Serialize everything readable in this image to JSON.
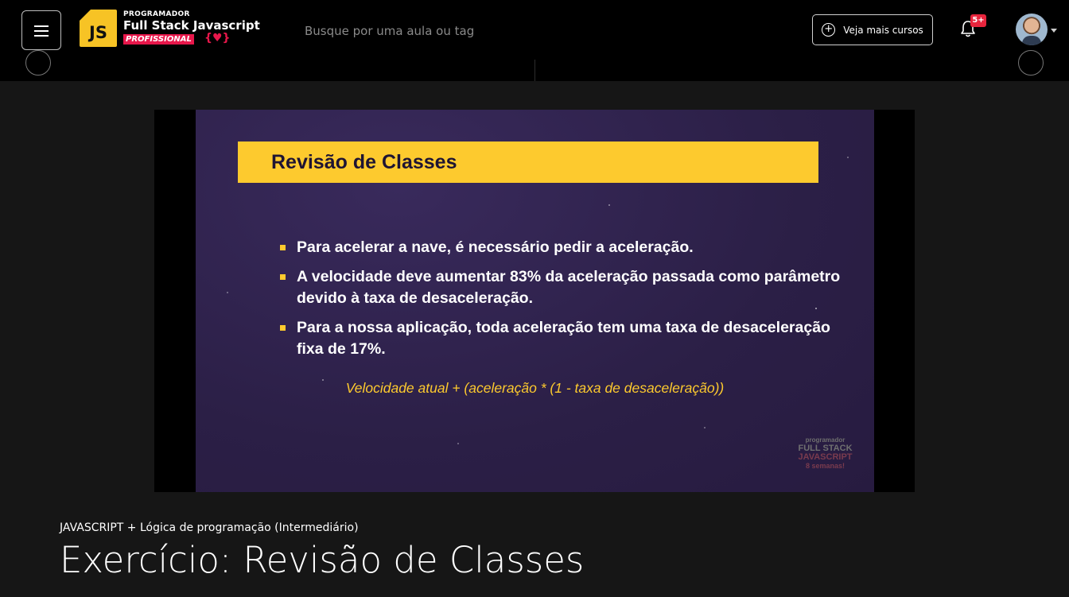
{
  "header": {
    "logo": {
      "badge": "JS",
      "line1": "PROGRAMADOR",
      "line2": "Full Stack Javascript",
      "line3": "PROFISSIONAL",
      "line4": "{♥}"
    },
    "search_placeholder": "Busque por uma aula ou tag",
    "more_courses_label": "Veja mais cursos",
    "notifications_badge": "5+"
  },
  "slide": {
    "title": "Revisão de Classes",
    "bullets": [
      "Para acelerar a nave, é necessário pedir a aceleração.",
      "A velocidade deve aumentar 83% da aceleração passada como parâmetro devido à taxa de desaceleração.",
      "Para a nossa aplicação, toda aceleração tem uma taxa de desaceleração fixa de 17%."
    ],
    "formula": "Velocidade atual + (aceleração * (1 - taxa de desaceleração))",
    "watermark": {
      "line1": "programador",
      "line2": "FULL STACK",
      "line3": "JAVASCRIPT",
      "line4": "8 semanas!"
    }
  },
  "lesson": {
    "course": "JAVASCRIPT + Lógica de programação (Intermediário)",
    "title": "Exercício: Revisão de Classes"
  },
  "colors": {
    "accent_yellow": "#fdca2e",
    "brand_red": "#e8174b",
    "slide_bg": "#2b1f46"
  }
}
